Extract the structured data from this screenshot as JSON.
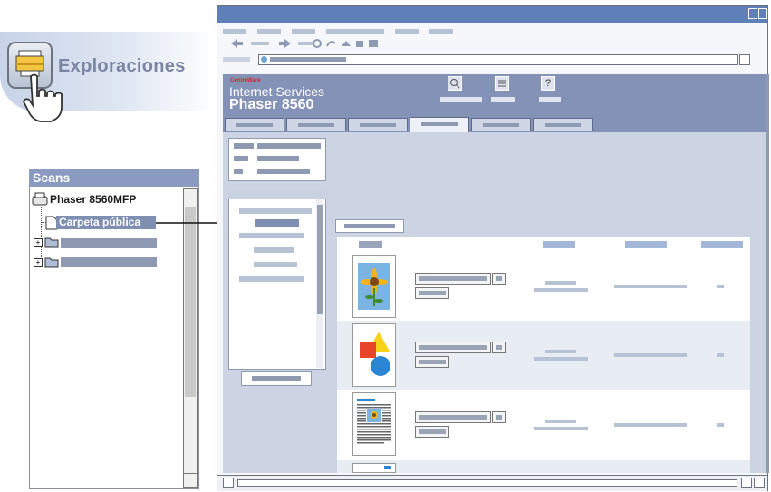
{
  "callout": {
    "label": "Exploraciones",
    "icon": "scan-hand-icon"
  },
  "scans_panel": {
    "title": "Scans",
    "tree": [
      {
        "label": "Phaser 8560MFP",
        "icon": "printer-icon"
      },
      {
        "label": "Carpeta pública",
        "icon": "folder-open-icon",
        "selected": true
      }
    ]
  },
  "browser": {
    "brand_small": "CentreWare",
    "brand_title": "Internet Services",
    "product": "Phaser 8560",
    "header_icons": [
      "search-icon",
      "index-icon",
      "help-icon"
    ],
    "help_glyph": "?"
  },
  "colors": {
    "header": "#8592b8",
    "content": "#ccd3e3",
    "titlebar": "#5e7fb8",
    "selected": "#7f8fb2"
  }
}
